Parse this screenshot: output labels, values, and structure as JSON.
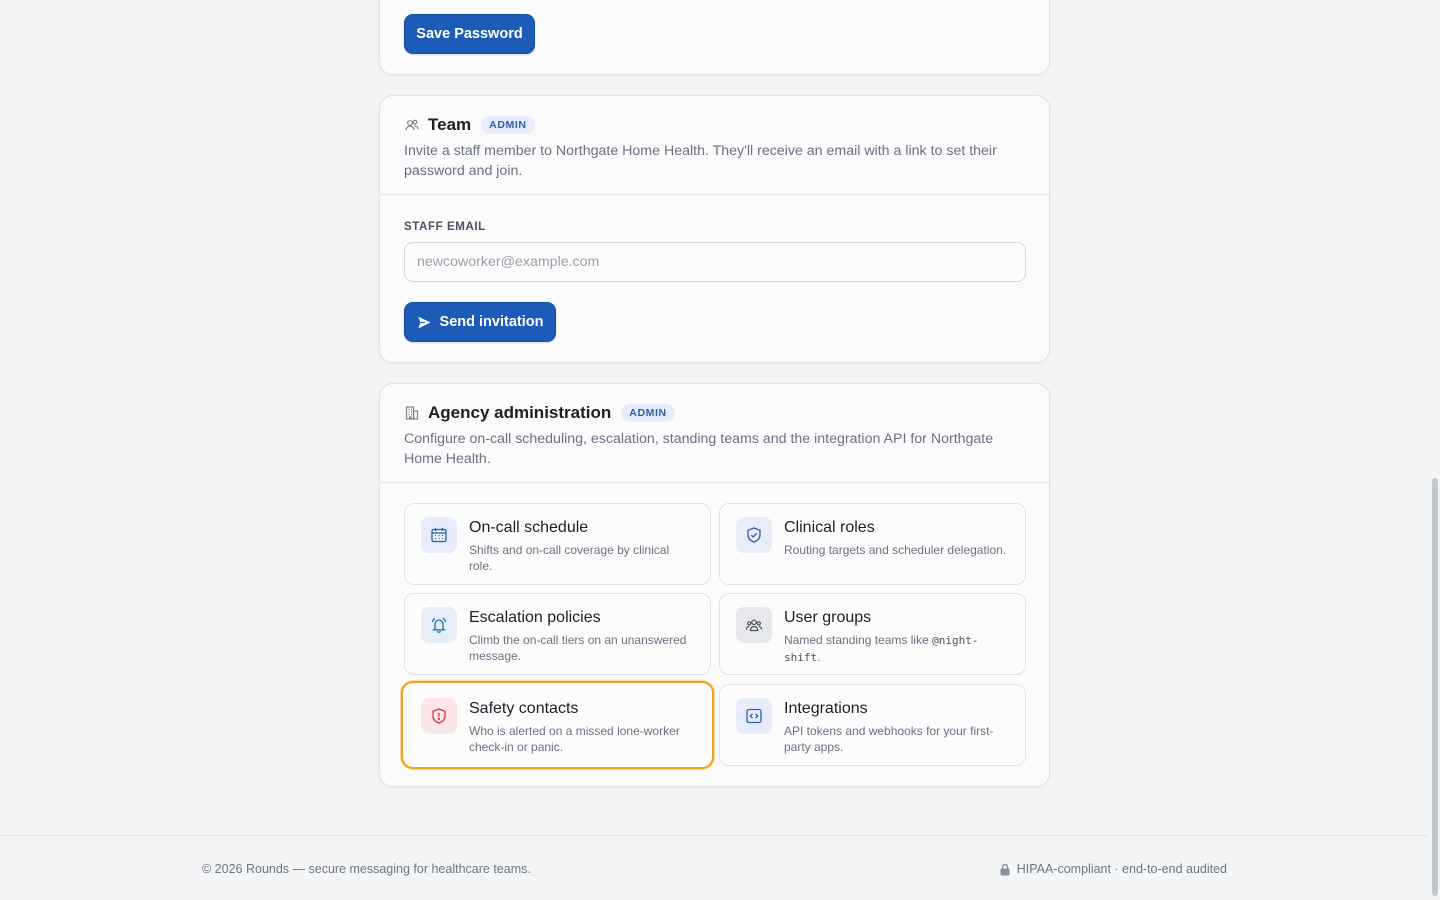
{
  "password": {
    "save_label": "Save Password"
  },
  "team": {
    "title": "Team",
    "badge": "ADMIN",
    "description": "Invite a staff member to Northgate Home Health. They'll receive an email with a link to set their password and join.",
    "email_label": "STAFF EMAIL",
    "email_placeholder": "newcoworker@example.com",
    "email_value": "",
    "send_label": "Send invitation"
  },
  "agency": {
    "title": "Agency administration",
    "badge": "ADMIN",
    "description": "Configure on-call scheduling, escalation, standing teams and the integration API for Northgate Home Health.",
    "tiles": [
      {
        "title": "On-call schedule",
        "desc": "Shifts and on-call coverage by clinical role.",
        "icon": "calendar-icon"
      },
      {
        "title": "Clinical roles",
        "desc": "Routing targets and scheduler delegation.",
        "icon": "shield-check-icon"
      },
      {
        "title": "Escalation policies",
        "desc": "Climb the on-call tiers on an unanswered message.",
        "icon": "bell-icon"
      },
      {
        "title": "User groups",
        "desc_prefix": "Named standing teams like ",
        "desc_code": "@night-shift",
        "desc_suffix": ".",
        "icon": "users-icon"
      },
      {
        "title": "Safety contacts",
        "desc": "Who is alerted on a missed lone-worker check-in or panic.",
        "icon": "shield-alert-icon"
      },
      {
        "title": "Integrations",
        "desc": "API tokens and webhooks for your first-party apps.",
        "icon": "code-icon"
      }
    ]
  },
  "footer": {
    "left": "© 2026 Rounds — secure messaging for healthcare teams.",
    "right": "HIPAA-compliant · end-to-end audited",
    "right_icon": "lock-icon"
  },
  "colors": {
    "primary": "#1d5bb8",
    "highlight": "#f0a21a",
    "badge_bg": "#e7edf8",
    "danger": "#d2343f"
  }
}
